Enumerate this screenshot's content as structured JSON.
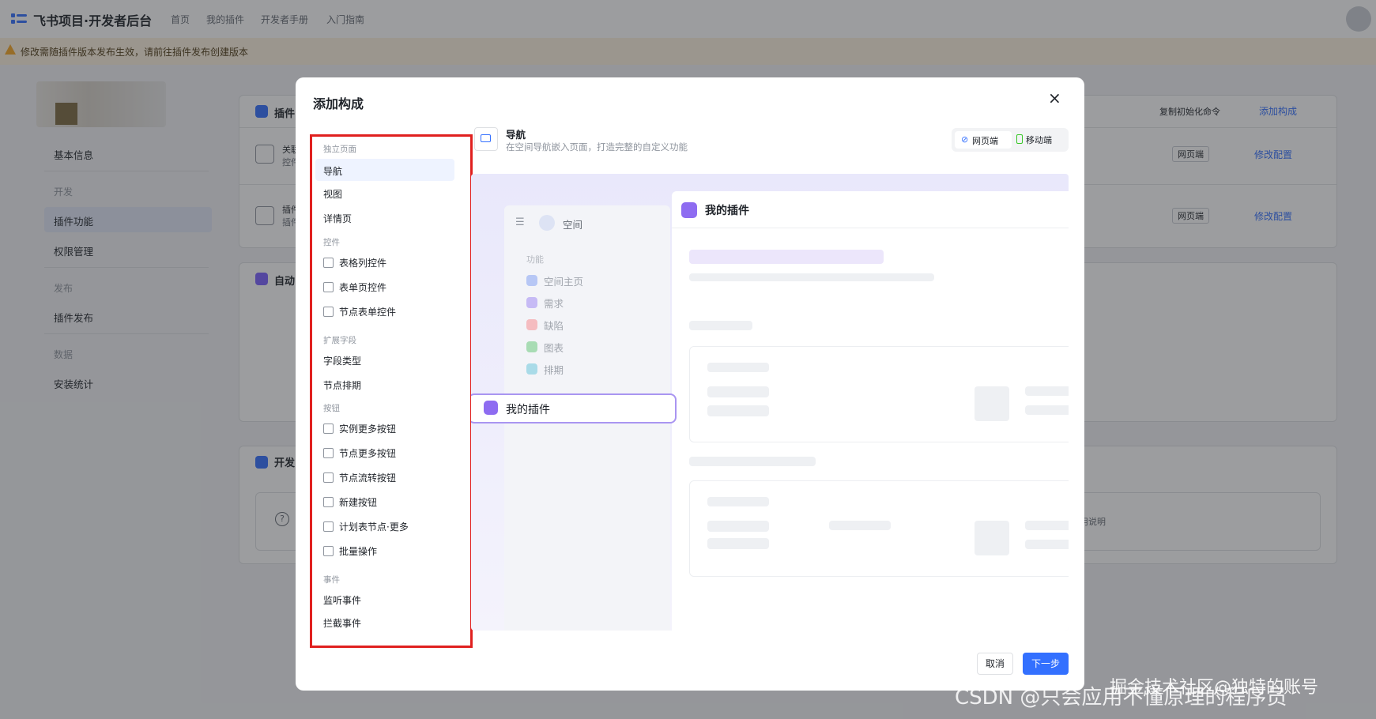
{
  "app": {
    "title": "飞书项目·开发者后台"
  },
  "topnav": {
    "items": [
      "首页",
      "我的插件",
      "开发者手册",
      "入门指南"
    ]
  },
  "banner": {
    "text": "修改需随插件版本发布生效，请前往插件发布创建版本"
  },
  "sidebar": {
    "basic": "基本信息",
    "dev_header": "开发",
    "plugin_feature": "插件功能",
    "permission": "权限管理",
    "publish_header": "发布",
    "plugin_publish": "插件发布",
    "data_header": "数据",
    "install_stats": "安装统计"
  },
  "background": {
    "card1_title": "插件",
    "card1_row1_title": "关联",
    "card1_row1_sub": "控件",
    "card1_row2_title": "插件",
    "card1_row2_sub": "插件",
    "copy_cmd": "复制初始化命令",
    "add_component": "添加构成",
    "web_tag": "网页端",
    "edit_config": "修改配置",
    "card2_title": "自动",
    "card3_title": "开发",
    "card3_tail": "用说明"
  },
  "modal": {
    "title": "添加构成",
    "groups": {
      "standalone": "独立页面",
      "controls": "控件",
      "ext_fields": "扩展字段",
      "buttons": "按钮",
      "events": "事件"
    },
    "standalone_items": [
      "导航",
      "视图",
      "详情页"
    ],
    "control_items": [
      "表格列控件",
      "表单页控件",
      "节点表单控件"
    ],
    "ext_items": [
      "字段类型",
      "节点排期"
    ],
    "button_items": [
      "实例更多按钮",
      "节点更多按钮",
      "节点流转按钮",
      "新建按钮",
      "计划表节点·更多",
      "批量操作"
    ],
    "event_items": [
      "监听事件",
      "拦截事件"
    ],
    "selected": {
      "title": "导航",
      "desc": "在空间导航嵌入页面，打造完整的自定义功能"
    },
    "platform": {
      "web": "网页端",
      "mobile": "移动端"
    },
    "preview": {
      "space_label": "空间",
      "func_header": "功能",
      "func_items": [
        "空间主页",
        "需求",
        "缺陷",
        "图表",
        "排期"
      ],
      "my_plugin": "我的插件",
      "main_title": "我的插件"
    },
    "cancel": "取消",
    "next": "下一步"
  },
  "watermark": {
    "csdn": "CSDN @只会应用不懂原理的程序员",
    "juejin": "掘金技术社区@独特的账号"
  },
  "colors": {
    "primary": "#3370ff",
    "highlight_border": "#e0201f",
    "plugin_purple": "#8e6cf1"
  }
}
